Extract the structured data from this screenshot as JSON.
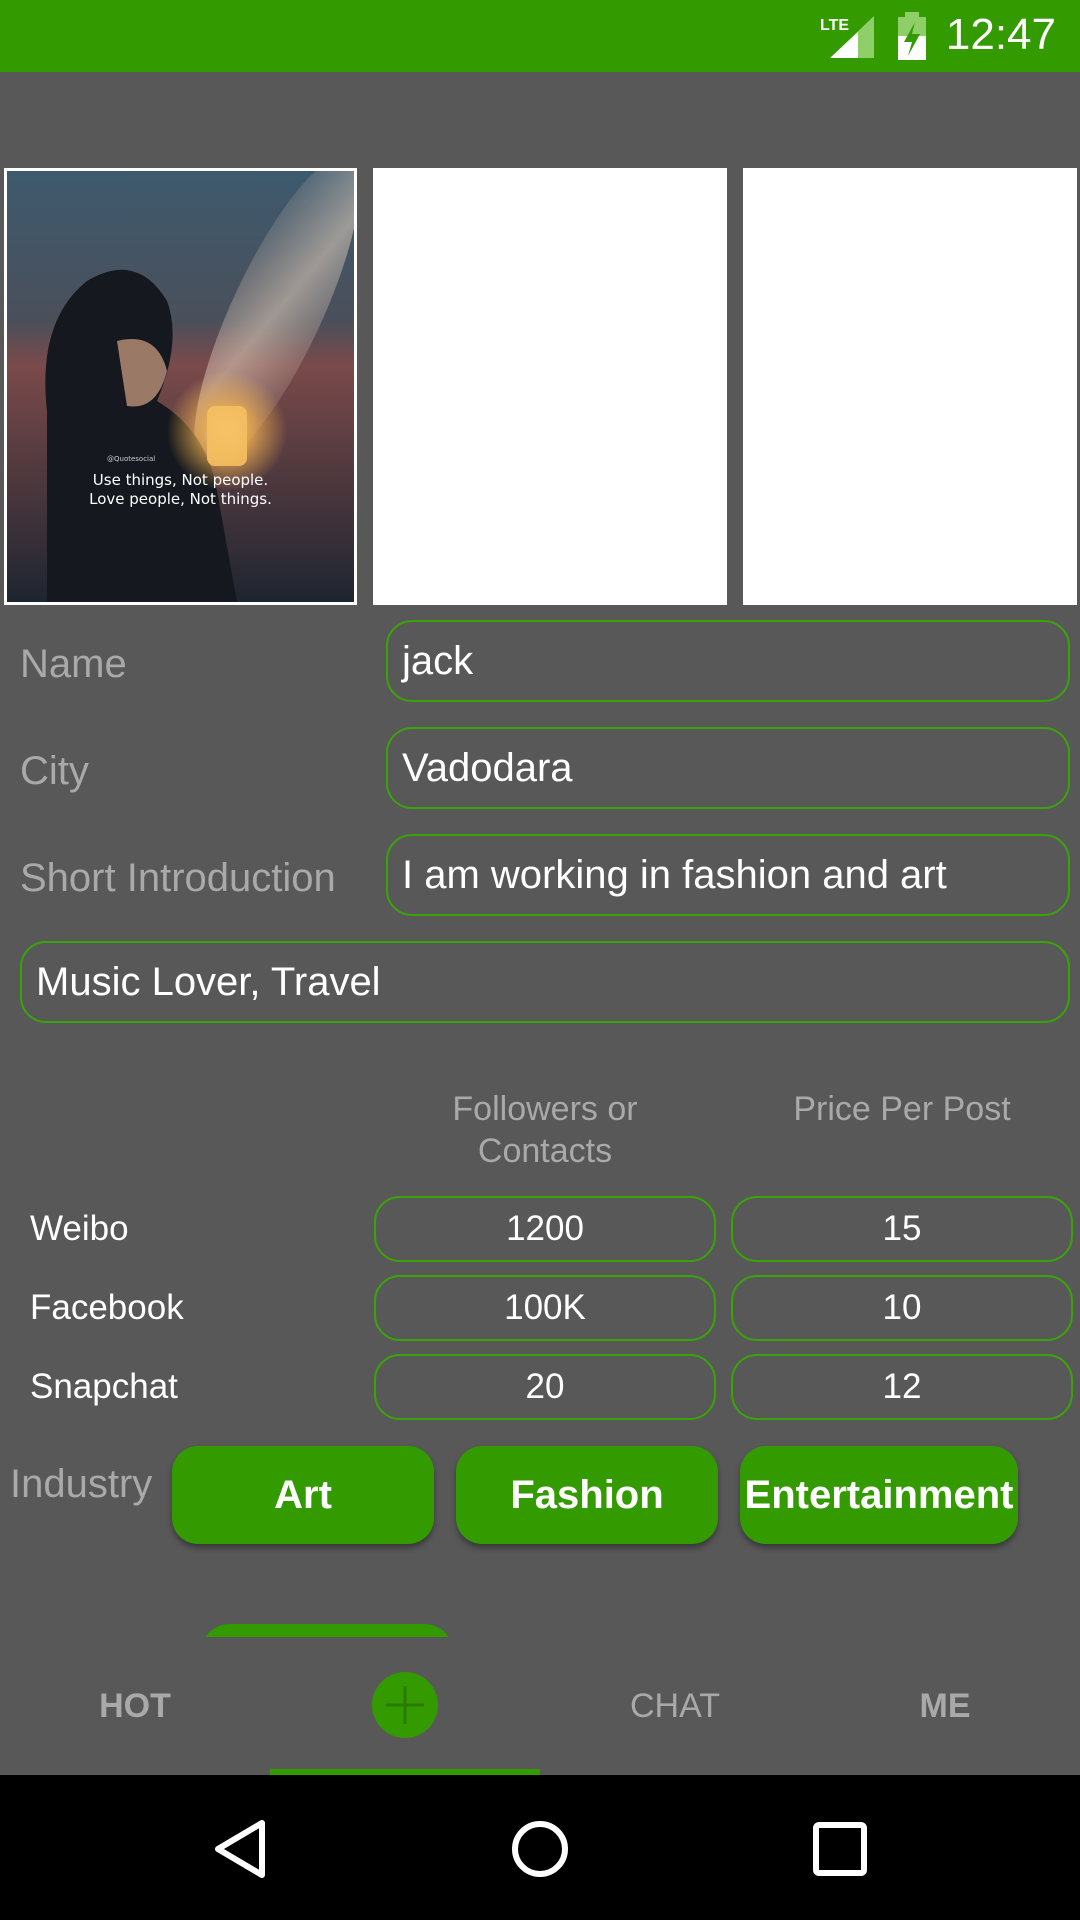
{
  "status_bar": {
    "time": "12:47",
    "network": "LTE",
    "icons": [
      "lte-signal-icon",
      "battery-charging-icon"
    ],
    "color": "#339a00"
  },
  "photos": [
    {
      "caption_lines": [
        "Use things, Not people.",
        "Love people, Not things."
      ],
      "watermark": "@Quotesocial"
    },
    {
      "empty": true
    },
    {
      "empty": true
    }
  ],
  "form": {
    "name_label": "Name",
    "name_value": "jack",
    "city_label": "City",
    "city_value": "Vadodara",
    "intro_label": "Short Introduction",
    "intro_value": "I am working in fashion and art",
    "interests_value": "Music Lover, Travel"
  },
  "social": {
    "followers_header_line1": "Followers or",
    "followers_header_line2": "Contacts",
    "price_header": "Price Per Post",
    "rows": [
      {
        "platform": "Weibo",
        "followers": "1200",
        "price": "15"
      },
      {
        "platform": "Facebook",
        "followers": "100K",
        "price": "10"
      },
      {
        "platform": "Snapchat",
        "followers": "20",
        "price": "12"
      }
    ]
  },
  "industry": {
    "label": "Industry",
    "options": [
      "Art",
      "Fashion",
      "Entertainment"
    ]
  },
  "bottom_nav": {
    "tabs": [
      "HOT",
      "",
      "CHAT",
      "ME"
    ],
    "active_index": 1,
    "center_icon": "plus-icon"
  },
  "system_nav": {
    "icons": [
      "back-icon",
      "home-icon",
      "recents-icon"
    ]
  },
  "colors": {
    "accent": "#339a00",
    "background": "#585858",
    "field_border": "#3aa30a",
    "label": "#a9a9a9"
  }
}
